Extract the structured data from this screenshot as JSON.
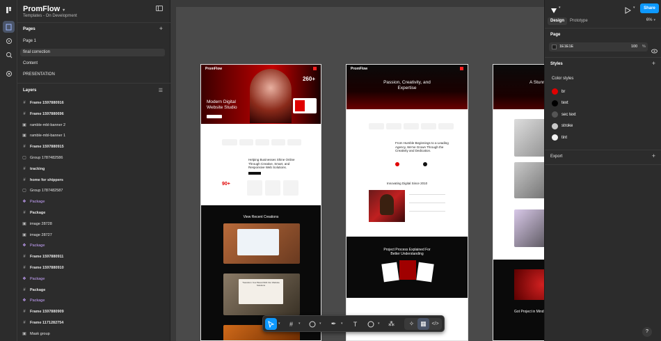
{
  "colors": {
    "accent": "#0d99ff",
    "component": "#c9a4ff",
    "brand_red": "#e00000"
  },
  "file": {
    "name": "PromFlow",
    "subtitle": "Templates - On Development"
  },
  "pages": {
    "title": "Pages",
    "items": [
      {
        "label": "Page 1"
      },
      {
        "label": "final correction",
        "selected": true
      },
      {
        "label": "Content"
      },
      {
        "label": "PRESENTATION"
      }
    ]
  },
  "layers": {
    "title": "Layers",
    "items": [
      {
        "label": "Frame 1597880916",
        "icon": "frame-icon",
        "bold": true
      },
      {
        "label": "Frame 1597880696",
        "icon": "frame-icon",
        "bold": true
      },
      {
        "label": "ramble-mbl-banner 2",
        "icon": "image-icon"
      },
      {
        "label": "ramble-mbl-banner 1",
        "icon": "image-icon"
      },
      {
        "label": "Frame 1597880915",
        "icon": "frame-icon",
        "bold": true
      },
      {
        "label": "Group 1787482586",
        "icon": "group-icon"
      },
      {
        "label": "tracking",
        "icon": "frame-icon",
        "bold": true
      },
      {
        "label": "home for shippers",
        "icon": "frame-icon",
        "bold": true
      },
      {
        "label": "Group 1787482587",
        "icon": "group-icon"
      },
      {
        "label": "Package",
        "icon": "component-icon",
        "component": true
      },
      {
        "label": "Package",
        "icon": "frame-icon",
        "bold": true
      },
      {
        "label": "image 28728",
        "icon": "image-icon"
      },
      {
        "label": "image 28727",
        "icon": "image-icon"
      },
      {
        "label": "Package",
        "icon": "component-icon",
        "component": true
      },
      {
        "label": "Frame 1597880911",
        "icon": "frame-icon",
        "bold": true
      },
      {
        "label": "Frame 1597880910",
        "icon": "frame-icon",
        "bold": true
      },
      {
        "label": "Package",
        "icon": "component-icon",
        "component": true
      },
      {
        "label": "Package",
        "icon": "frame-icon",
        "bold": true
      },
      {
        "label": "Package",
        "icon": "component-icon",
        "component": true
      },
      {
        "label": "Frame 1597880909",
        "icon": "frame-icon",
        "bold": true
      },
      {
        "label": "Frame 1171282754",
        "icon": "frame-icon",
        "bold": true
      },
      {
        "label": "Mask group",
        "icon": "image-icon"
      }
    ]
  },
  "right": {
    "tabs": {
      "design": "Design",
      "prototype": "Prototype"
    },
    "zoom": "6%",
    "share": "Share",
    "page": {
      "title": "Page",
      "color_hex": "1E1E1E",
      "opacity": "100",
      "percent": "%"
    },
    "styles": {
      "title": "Styles",
      "color_styles_title": "Color styles",
      "items": [
        {
          "name": "br",
          "color": "#e00000"
        },
        {
          "name": "text",
          "color": "#000000"
        },
        {
          "name": "sec text",
          "color": "#555555"
        },
        {
          "name": "stroke",
          "color": "#c8c8c8"
        },
        {
          "name": "tint",
          "color": "#f2f2f2"
        }
      ]
    },
    "export": {
      "title": "Export"
    }
  },
  "frames": {
    "one": {
      "logo": "PromFlow",
      "stat": "260+",
      "hero_title": "Modern Digital Website Studio",
      "services": "Helping Businesses Shine Online Through Creative, Smart, and Responsive Web Solutions.",
      "count": "90+",
      "recent": "View Recent Creations",
      "feature": "Transform Your Brand With Our Website Solutions"
    },
    "two": {
      "logo": "PromFlow",
      "hero_title": "Passion, Creativity, and Expertise",
      "intro": "From Humble Beginnings to a Leading Agency, We've Grown Through the Creativity and Dedication.",
      "since": "Innovating Digital Since 2010",
      "process": "Project Process Explained For Better Understanding"
    },
    "three": {
      "hero_title": "A Stunni Innov",
      "cta": "Got Project in Mind"
    }
  },
  "help": "?"
}
